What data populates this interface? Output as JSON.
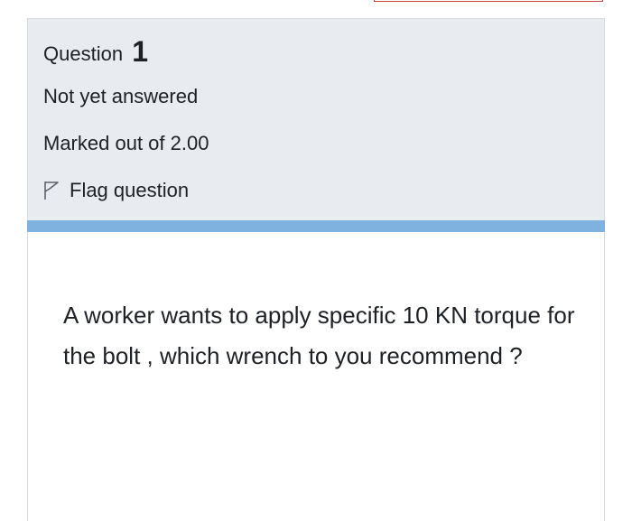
{
  "question": {
    "label": "Question",
    "number": "1",
    "state": "Not yet answered",
    "grade": "Marked out of 2.00",
    "flag_label": "Flag question",
    "flag_icon": "flag-icon"
  },
  "question_text": "A worker wants to apply specific 10 KN torque for the bolt , which wrench to you recommend ?",
  "colors": {
    "info_background": "#e8ebef",
    "accent_bar": "#7fb2df",
    "top_box_border": "#c9413f"
  }
}
